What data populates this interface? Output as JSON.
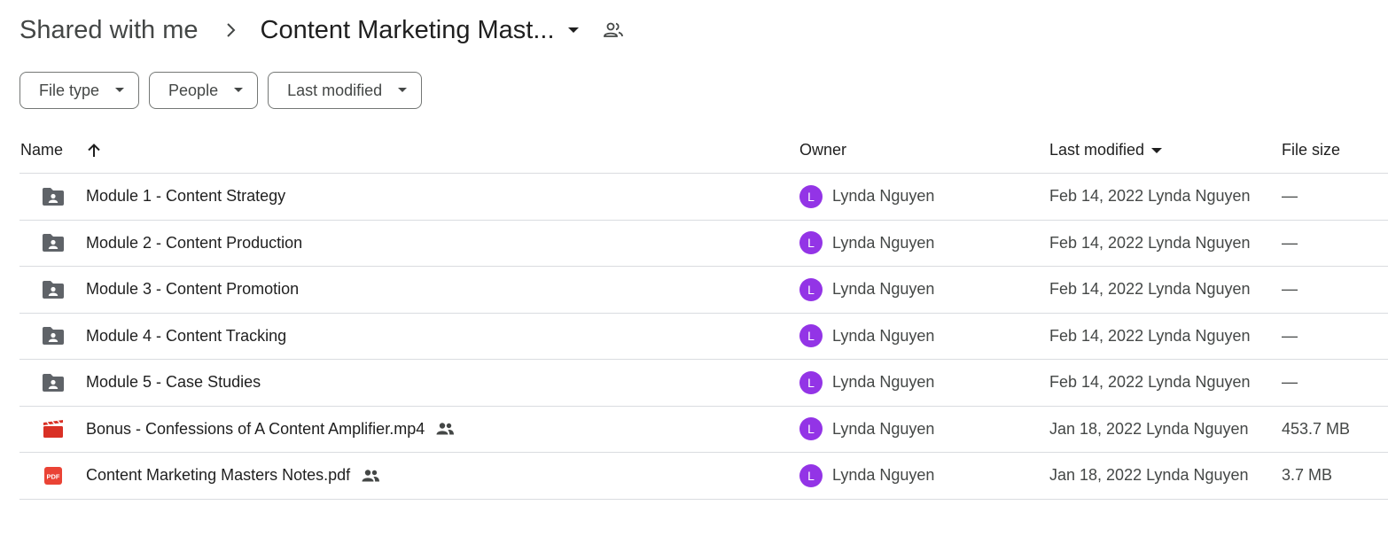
{
  "breadcrumb": {
    "parent": "Shared with me",
    "current": "Content Marketing Mast..."
  },
  "filters": [
    {
      "label": "File type"
    },
    {
      "label": "People"
    },
    {
      "label": "Last modified"
    }
  ],
  "columns": {
    "name": "Name",
    "owner": "Owner",
    "last_modified": "Last modified",
    "file_size": "File size"
  },
  "colors": {
    "avatar": "#9334e6",
    "folder_icon": "#5f6368",
    "video_icon": "#d93025",
    "pdf_icon": "#ea4335",
    "divider": "#dadce0"
  },
  "rows": [
    {
      "icon": "shared-folder-icon",
      "name": "Module 1 - Content Strategy",
      "shared": false,
      "owner_initial": "L",
      "owner": "Lynda Nguyen",
      "modified": "Feb 14, 2022 Lynda Nguyen",
      "size": "—"
    },
    {
      "icon": "shared-folder-icon",
      "name": "Module 2 - Content Production",
      "shared": false,
      "owner_initial": "L",
      "owner": "Lynda Nguyen",
      "modified": "Feb 14, 2022 Lynda Nguyen",
      "size": "—"
    },
    {
      "icon": "shared-folder-icon",
      "name": "Module 3 - Content Promotion",
      "shared": false,
      "owner_initial": "L",
      "owner": "Lynda Nguyen",
      "modified": "Feb 14, 2022 Lynda Nguyen",
      "size": "—"
    },
    {
      "icon": "shared-folder-icon",
      "name": "Module 4 - Content Tracking",
      "shared": false,
      "owner_initial": "L",
      "owner": "Lynda Nguyen",
      "modified": "Feb 14, 2022 Lynda Nguyen",
      "size": "—"
    },
    {
      "icon": "shared-folder-icon",
      "name": "Module 5 - Case Studies",
      "shared": false,
      "owner_initial": "L",
      "owner": "Lynda Nguyen",
      "modified": "Feb 14, 2022 Lynda Nguyen",
      "size": "—"
    },
    {
      "icon": "video-file-icon",
      "name": "Bonus - Confessions of A Content Amplifier.mp4",
      "shared": true,
      "owner_initial": "L",
      "owner": "Lynda Nguyen",
      "modified": "Jan 18, 2022 Lynda Nguyen",
      "size": "453.7 MB"
    },
    {
      "icon": "pdf-file-icon",
      "name": "Content Marketing Masters Notes.pdf",
      "shared": true,
      "owner_initial": "L",
      "owner": "Lynda Nguyen",
      "modified": "Jan 18, 2022 Lynda Nguyen",
      "size": "3.7 MB"
    }
  ]
}
